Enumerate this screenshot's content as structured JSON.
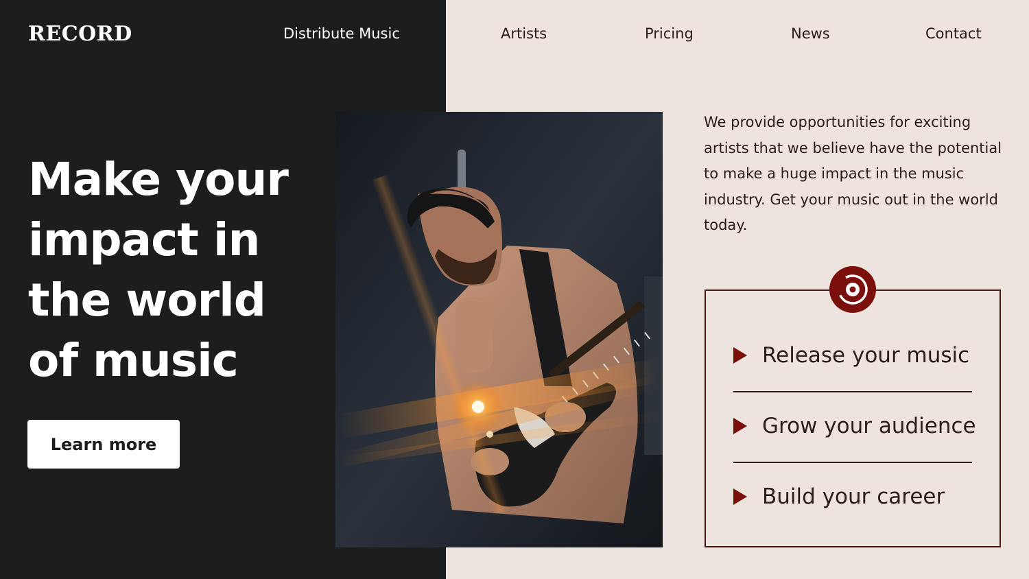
{
  "brand": {
    "logo": "RECORD"
  },
  "nav": {
    "distribute": "Distribute Music",
    "artists": "Artists",
    "pricing": "Pricing",
    "news": "News",
    "contact": "Contact"
  },
  "hero": {
    "title": "Make your impact in the world of music",
    "cta_label": "Learn more"
  },
  "intro": {
    "text": "We provide opportunities for exciting artists that we believe have the potential to make a huge impact in the music industry. Get your music out in the world today."
  },
  "features": [
    {
      "label": "Release your music",
      "icon": "play-triangle-icon"
    },
    {
      "label": "Grow your audience",
      "icon": "play-triangle-icon"
    },
    {
      "label": "Build your career",
      "icon": "play-triangle-icon"
    }
  ],
  "badge": {
    "icon": "vinyl-record-icon"
  },
  "colors": {
    "dark_panel": "#1d1d1d",
    "light_panel": "#ede4de",
    "accent": "#7a0f0b",
    "text_dark": "#2b1d18",
    "text_light": "#ffffff"
  }
}
